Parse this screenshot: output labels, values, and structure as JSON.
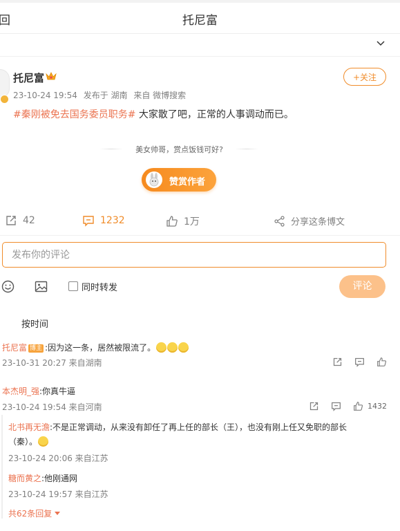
{
  "header": {
    "back_label": "回",
    "title": "托尼富"
  },
  "post": {
    "author": "托尼富",
    "follow_label": "+关注",
    "time": "23-10-24 19:54",
    "location": "发布于 湖南",
    "source": "来自 微博搜索",
    "hashtag": "#秦刚被免去国务委员职务#",
    "text": " 大家散了吧，正常的人事调动而已。",
    "reward_prompt": "美女帅哥，赏点饭钱可好?",
    "reward_button": "赞赏作者"
  },
  "actions": {
    "repost_count": "42",
    "comment_count": "1232",
    "like_count": "1万",
    "share_label": "分享这条博文"
  },
  "comment_box": {
    "placeholder": "发布你的评论",
    "repost_checkbox_label": "同时转发",
    "submit_label": "评论"
  },
  "sort_label": "按时间",
  "comments": [
    {
      "user": "托尼富",
      "badge": "博主",
      "text": ":因为这一条，居然被限流了。",
      "meta": "23-10-31 20:27 来自湖南"
    },
    {
      "user": "本杰明_强",
      "text": ":你真牛逼",
      "meta": "23-10-24 19:54 来自河南",
      "likes": "1432",
      "replies": [
        {
          "user": "北书再无澹",
          "text_line1": ":不是正常调动，从来没有卸任了再上任的部长（王），也没有刚上任又免职的部长",
          "text_line2": "（秦）。",
          "meta": "23-10-24 20:06 来自江苏"
        },
        {
          "user": "糖而黄之",
          "text": ":他刚通网",
          "meta": "23-10-24 19:57 来自江苏"
        }
      ],
      "more_replies": "共62条回复"
    }
  ],
  "colors": {
    "accent": "#f08c2a",
    "link": "#eb7350",
    "submit_disabled": "#fcc18a"
  },
  "icons": [
    "chevron-down-icon",
    "crown-icon",
    "verified-badge-icon",
    "repost-icon",
    "comment-icon",
    "like-icon",
    "share-icon",
    "emoji-icon",
    "image-icon",
    "caret-down-icon"
  ]
}
